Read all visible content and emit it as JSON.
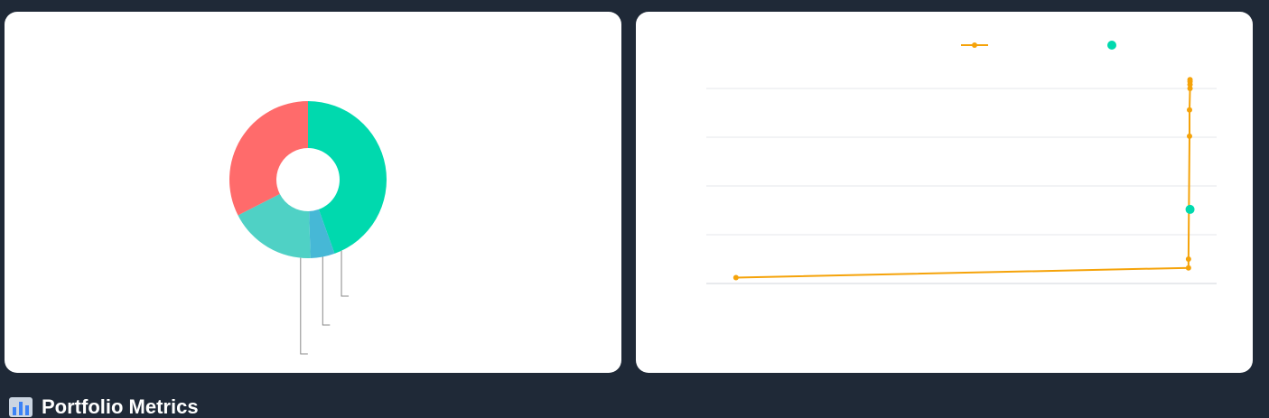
{
  "colors": {
    "page_background": "#1f2937",
    "card_background": "#ffffff",
    "slice_green": "#00d9ae",
    "slice_blue": "#46b8d6",
    "slice_teal": "#4fd1c5",
    "slice_red": "#ff6b6b",
    "line_series": "#f5a30a",
    "scatter_series": "#00d9ae",
    "grid": "#e5e7eb",
    "leader_line": "#888888"
  },
  "section": {
    "icon": "bar-chart-icon",
    "title": "Portfolio Metrics"
  },
  "chart_data": [
    {
      "type": "pie",
      "variant": "donut",
      "title": "",
      "slices": [
        {
          "color": "#00d9ae",
          "fraction": 0.445
        },
        {
          "color": "#46b8d6",
          "fraction": 0.05
        },
        {
          "color": "#4fd1c5",
          "fraction": 0.18
        },
        {
          "color": "#ff6b6b",
          "fraction": 0.325
        }
      ],
      "labels_visible": false
    },
    {
      "type": "line",
      "title": "",
      "legend_position": "top-right",
      "grid": true,
      "series": [
        {
          "kind": "line",
          "color": "#f5a30a",
          "points": [
            [
              0.0,
              0.03
            ],
            [
              0.885,
              0.08
            ],
            [
              0.885,
              0.125
            ],
            [
              0.887,
              0.755
            ],
            [
              0.887,
              0.89
            ],
            [
              0.888,
              1.0
            ],
            [
              0.888,
              1.02
            ],
            [
              0.888,
              1.035
            ],
            [
              0.888,
              1.045
            ]
          ]
        },
        {
          "kind": "scatter",
          "color": "#00d9ae",
          "points": [
            [
              0.888,
              0.38
            ]
          ]
        }
      ],
      "ylim": [
        0,
        1.0
      ],
      "xlim": [
        -0.058,
        0.94
      ]
    }
  ]
}
